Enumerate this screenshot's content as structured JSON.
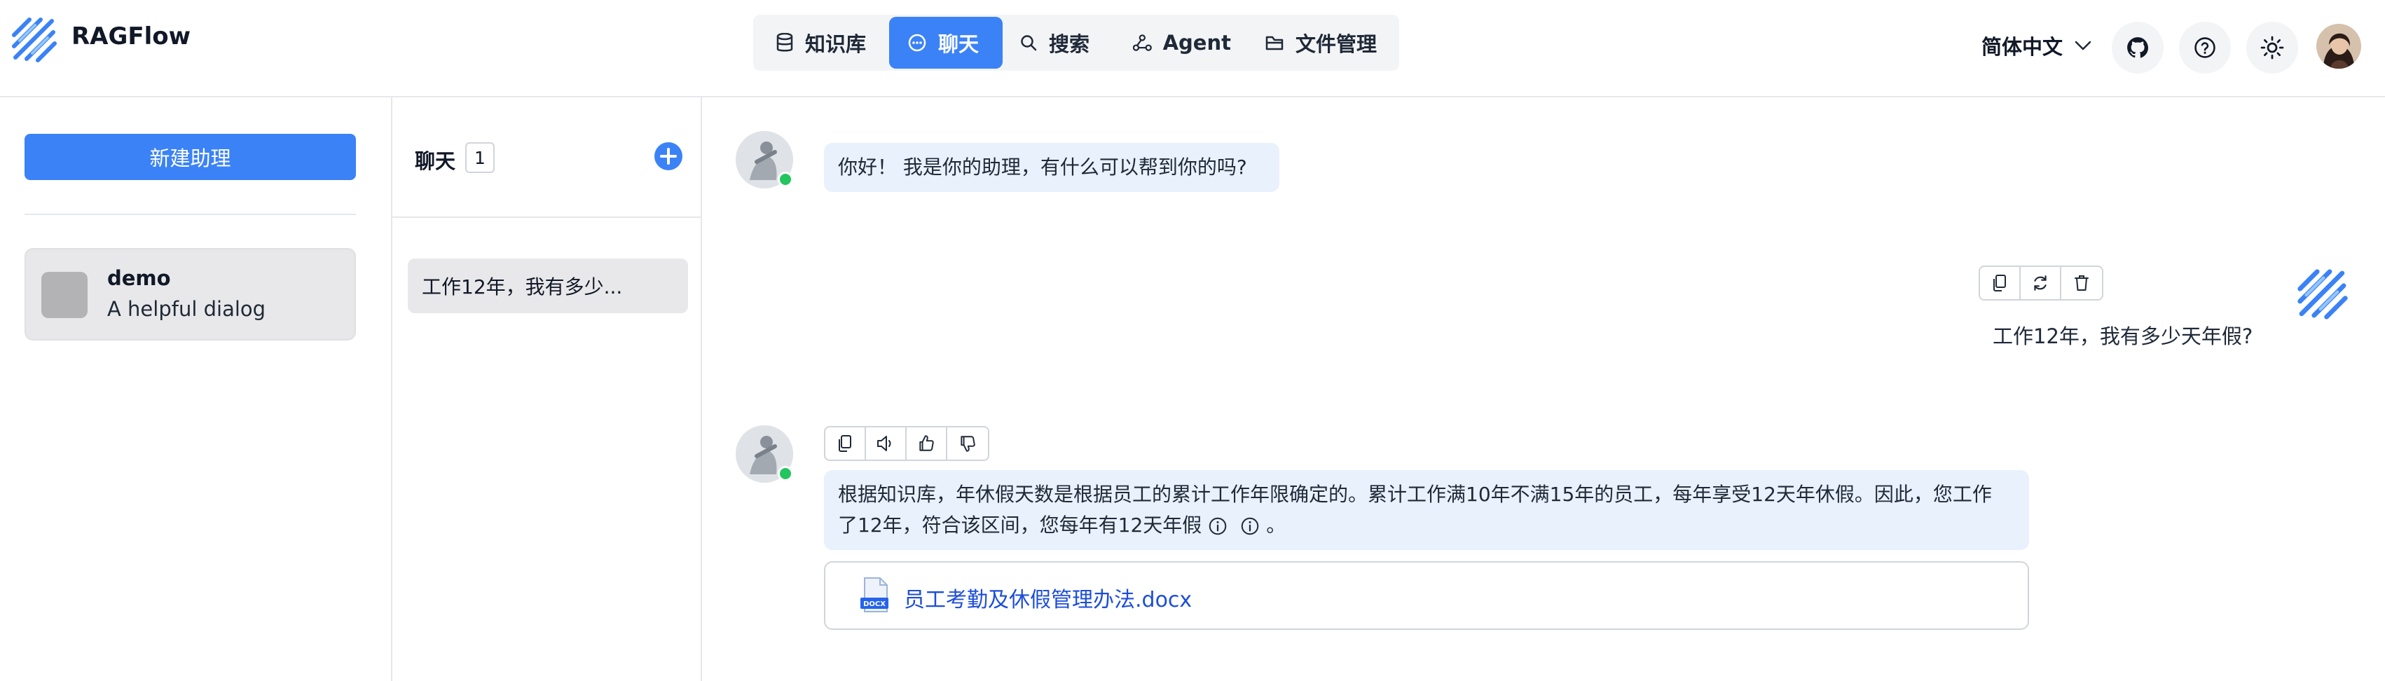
{
  "app": {
    "title": "RAGFlow"
  },
  "nav": {
    "items": [
      {
        "label": "知识库",
        "icon": "database-icon"
      },
      {
        "label": "聊天",
        "icon": "chat-icon",
        "active": true
      },
      {
        "label": "搜索",
        "icon": "search-icon"
      },
      {
        "label": "Agent",
        "icon": "agent-graph-icon"
      },
      {
        "label": "文件管理",
        "icon": "folder-icon"
      }
    ],
    "active_color": "#3b82f6"
  },
  "header_right": {
    "language": "简体中文",
    "icons": [
      "github-icon",
      "help-icon",
      "theme-sun-icon",
      "user-avatar"
    ]
  },
  "sidebar": {
    "new_button": "新建助理",
    "assistants": [
      {
        "name": "demo",
        "description": "A helpful dialog"
      }
    ]
  },
  "conversations": {
    "title": "聊天",
    "count": "1",
    "items": [
      {
        "label": "工作12年，我有多少..."
      }
    ]
  },
  "chat": {
    "messages": [
      {
        "role": "assistant",
        "text": "你好！ 我是你的助理，有什么可以帮到你的吗?"
      },
      {
        "role": "user",
        "text": "工作12年，我有多少天年假?"
      },
      {
        "role": "assistant",
        "text_line1": "根据知识库，年休假天数是根据员工的累计工作年限确定的。累计工作满10年不满15年的员工，每年享受12天年休假。因此，您工作",
        "text_line2": "了12年，符合该区间，您每年有12天年假",
        "text_end": "。",
        "reference_file": "员工考勤及休假管理办法.docx",
        "file_badge": "DOCX"
      }
    ],
    "bubble_color": "#e8f1fc",
    "online_color": "#22c55e"
  }
}
